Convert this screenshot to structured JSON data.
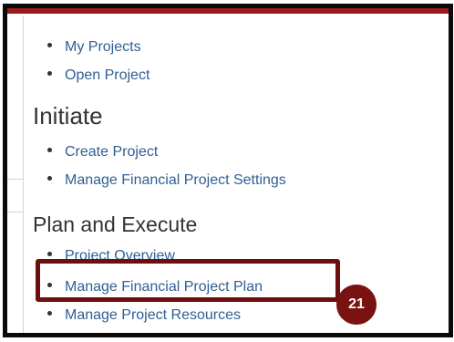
{
  "menu_top": [
    {
      "label": "My Projects"
    },
    {
      "label": "Open Project"
    }
  ],
  "sections": {
    "initiate": {
      "title": "Initiate",
      "items": [
        {
          "label": "Create Project"
        },
        {
          "label": "Manage Financial Project Settings"
        }
      ]
    },
    "plan_execute": {
      "title": "Plan and Execute",
      "items": [
        {
          "label": "Project Overview"
        },
        {
          "label": "Manage Financial Project Plan"
        },
        {
          "label": "Manage Project Resources"
        }
      ]
    }
  },
  "callout": {
    "step_number": "21"
  },
  "colors": {
    "link": "#2f5f93",
    "accent_bar": "#9b1b1b",
    "highlight_border": "#6d0f0f",
    "badge_bg": "#7a1212",
    "frame_border": "#0a0a0a"
  }
}
